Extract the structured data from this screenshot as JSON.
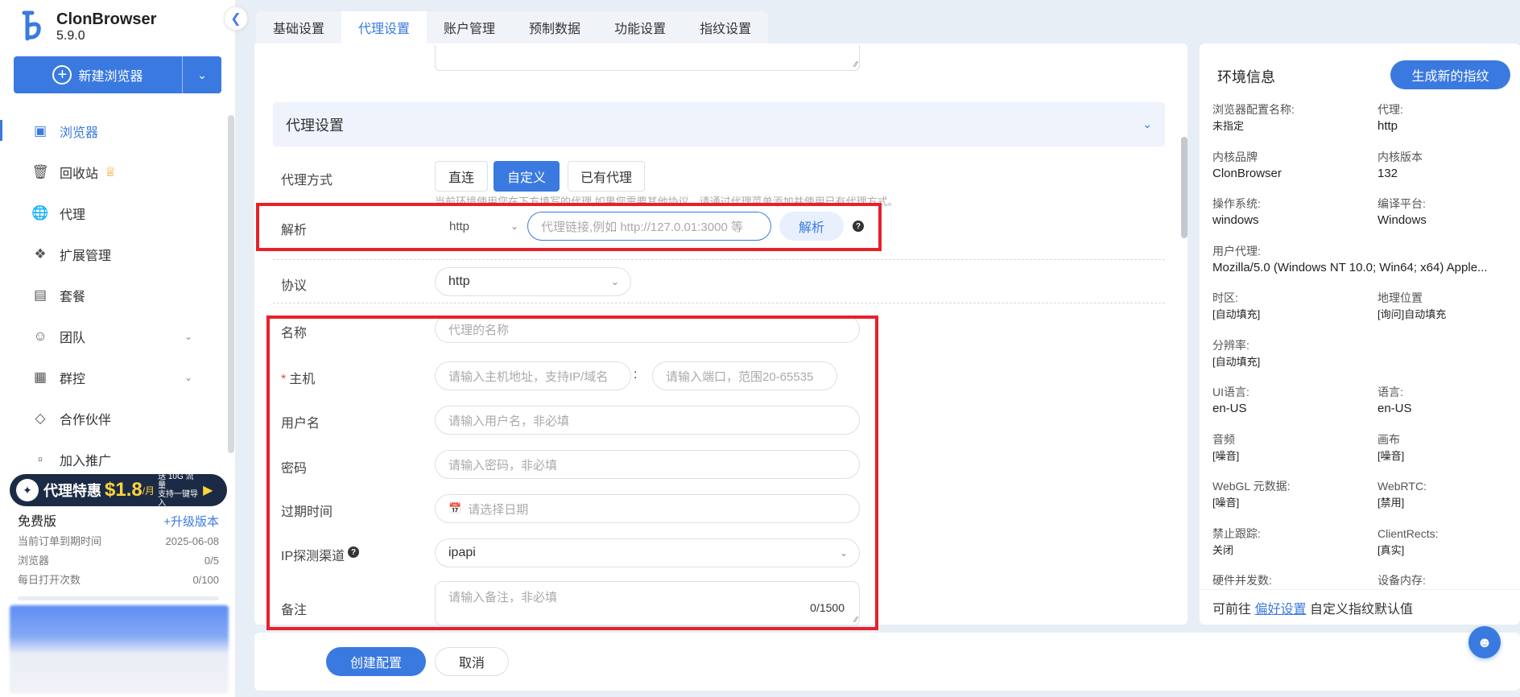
{
  "app": {
    "name": "ClonBrowser",
    "version": "5.9.0"
  },
  "sidebar": {
    "new_browser_label": "新建浏览器",
    "items": [
      {
        "label": "浏览器",
        "icon": "browser-icon",
        "active": true
      },
      {
        "label": "回收站",
        "icon": "trash-icon",
        "badge": "crown-icon"
      },
      {
        "label": "代理",
        "icon": "globe-icon"
      },
      {
        "label": "扩展管理",
        "icon": "puzzle-icon"
      },
      {
        "label": "套餐",
        "icon": "wallet-icon"
      },
      {
        "label": "团队",
        "icon": "team-icon",
        "expandable": true
      },
      {
        "label": "群控",
        "icon": "group-control-icon",
        "expandable": true
      },
      {
        "label": "合作伙伴",
        "icon": "handshake-icon"
      },
      {
        "label": "加入推广",
        "icon": "promotion-icon"
      }
    ],
    "promo": {
      "text": "代理特惠",
      "price": "$1.8",
      "unit": "/月",
      "sub_line1": "送 10G 流量",
      "sub_line2": "支持一键导入"
    },
    "plan": {
      "name": "免费版",
      "upgrade_label": "+升级版本",
      "rows": [
        {
          "label": "当前订单到期时间",
          "value": "2025-06-08"
        },
        {
          "label": "浏览器",
          "value": "0/5"
        },
        {
          "label": "每日打开次数",
          "value": "0/100"
        }
      ]
    }
  },
  "tabs": [
    "基础设置",
    "代理设置",
    "账户管理",
    "预制数据",
    "功能设置",
    "指纹设置"
  ],
  "active_tab": "代理设置",
  "proxy": {
    "section_title": "代理设置",
    "mode_label": "代理方式",
    "modes": [
      "直连",
      "自定义",
      "已有代理"
    ],
    "active_mode": "自定义",
    "hint": "当前环境使用您在下方填写的代理,如果您需要其他协议，请通过代理菜单添加并使用已有代理方式。",
    "parse_label": "解析",
    "parse_protocol": "http",
    "parse_placeholder": "代理链接,例如 http://127.0.01:3000 等",
    "parse_button": "解析",
    "protocol_label": "协议",
    "protocol_value": "http",
    "name_label": "名称",
    "name_placeholder": "代理的名称",
    "host_label": "主机",
    "host_placeholder": "请输入主机地址，支持IP/域名",
    "port_placeholder": "请输入端口，范围20-65535",
    "username_label": "用户名",
    "username_placeholder": "请输入用户名，非必填",
    "password_label": "密码",
    "password_placeholder": "请输入密码，非必填",
    "expire_label": "过期时间",
    "expire_placeholder": "请选择日期",
    "ip_channel_label": "IP探测渠道",
    "ip_channel_value": "ipapi",
    "remark_label": "备注",
    "remark_placeholder": "请输入备注，非必填",
    "remark_count": "0/1500"
  },
  "footer": {
    "create_label": "创建配置",
    "cancel_label": "取消"
  },
  "env": {
    "title": "环境信息",
    "generate_label": "生成新的指纹",
    "fields": [
      {
        "label": "浏览器配置名称:",
        "value": "未指定"
      },
      {
        "label": "代理:",
        "value": "http"
      },
      {
        "label": "内核品牌",
        "value": "ClonBrowser"
      },
      {
        "label": "内核版本",
        "value": "132"
      },
      {
        "label": "操作系统:",
        "value": "windows"
      },
      {
        "label": "编译平台:",
        "value": "Windows"
      },
      {
        "label": "用户代理:",
        "value": "Mozilla/5.0 (Windows NT 10.0; Win64; x64) Apple...",
        "wide": true
      },
      {
        "label": "时区:",
        "value": "[自动填充]"
      },
      {
        "label": "地理位置",
        "value": "[询问]自动填充"
      },
      {
        "label": "分辨率:",
        "value": "[自动填充]",
        "wide": true
      },
      {
        "label": "UI语言:",
        "value": "en-US"
      },
      {
        "label": "语言:",
        "value": "en-US"
      },
      {
        "label": "音频",
        "value": "[噪音]"
      },
      {
        "label": "画布",
        "value": "[噪音]"
      },
      {
        "label": "WebGL 元数据:",
        "value": "[噪音]"
      },
      {
        "label": "WebRTC:",
        "value": "[禁用]"
      },
      {
        "label": "禁止跟踪:",
        "value": "关闭"
      },
      {
        "label": "ClientRects:",
        "value": "[真实]"
      },
      {
        "label": "硬件并发数:",
        "value": ""
      },
      {
        "label": "设备内存:",
        "value": ""
      }
    ],
    "footer_prefix": "可前往",
    "footer_link": "偏好设置",
    "footer_suffix": "自定义指纹默认值"
  },
  "colors": {
    "accent": "#3a7ae0",
    "highlight_box": "#e8202a"
  }
}
